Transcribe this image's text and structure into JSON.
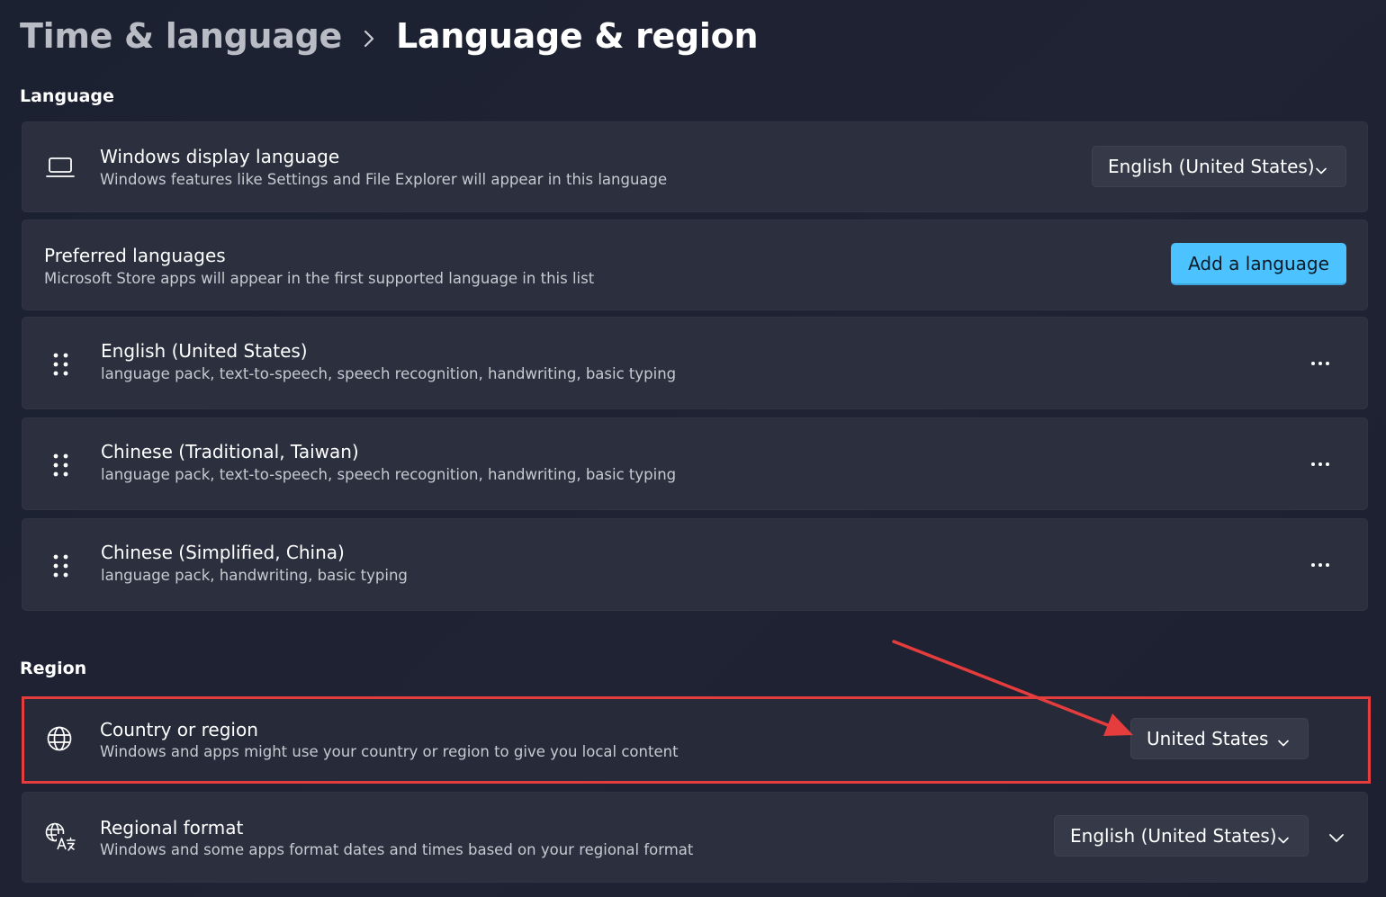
{
  "breadcrumb": {
    "parent": "Time & language",
    "current": "Language & region"
  },
  "sections": {
    "language": "Language",
    "region": "Region"
  },
  "display_language": {
    "title": "Windows display language",
    "subtitle": "Windows features like Settings and File Explorer will appear in this language",
    "value": "English (United States)",
    "icon": "laptop-icon"
  },
  "preferred_languages": {
    "title": "Preferred languages",
    "subtitle": "Microsoft Store apps will appear in the first supported language in this list",
    "button": "Add a language"
  },
  "languages": [
    {
      "name": "English (United States)",
      "features": "language pack, text-to-speech, speech recognition, handwriting, basic typing"
    },
    {
      "name": "Chinese (Traditional, Taiwan)",
      "features": "language pack, text-to-speech, speech recognition, handwriting, basic typing"
    },
    {
      "name": "Chinese (Simplified, China)",
      "features": "language pack, handwriting, basic typing"
    }
  ],
  "country": {
    "title": "Country or region",
    "subtitle": "Windows and apps might use your country or region to give you local content",
    "value": "United States",
    "icon": "globe-icon"
  },
  "regional_format": {
    "title": "Regional format",
    "subtitle": "Windows and some apps format dates and times based on your regional format",
    "value": "English (United States)",
    "icon": "language-format-icon"
  },
  "annotation": {
    "color": "#e53d3d"
  },
  "colors": {
    "accent": "#4cc2ff",
    "card": "#2b2f3e",
    "background": "#1c2131"
  }
}
